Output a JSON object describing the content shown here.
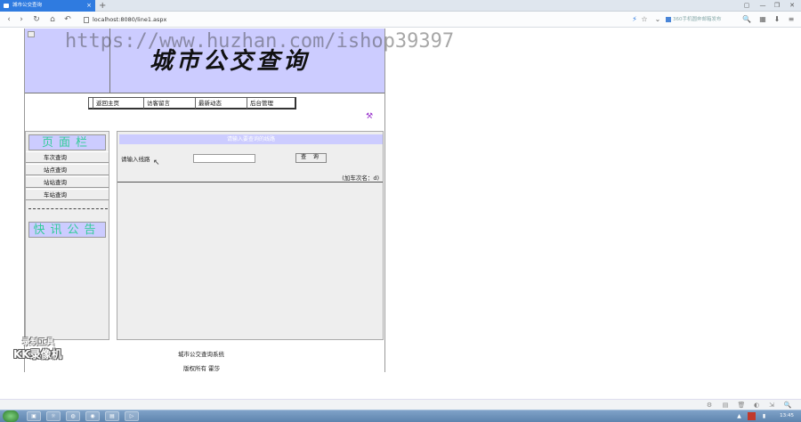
{
  "browser": {
    "tab_title": "城市公交查询",
    "tab_close": "×",
    "new_tab": "+",
    "url": "localhost:8080/line1.aspx",
    "search_placeholder": "360手机圆奔邮箱发布",
    "window_buttons": [
      "▢",
      "—",
      "❐",
      "✕"
    ],
    "nav_buttons": [
      "‹",
      "›",
      "↻",
      "⌂",
      "↶"
    ],
    "toolbar_icons": [
      "⚡",
      "☆",
      "⌄",
      "🔍",
      "▦",
      "⬇",
      "≡"
    ]
  },
  "page": {
    "watermark": "https://www.huzhan.com/ishop39397",
    "site_title": "城市公交查询",
    "nav_links": [
      "返回主页",
      "访客留言",
      "最新动态",
      "后台管理"
    ],
    "sidebar": {
      "header1": "页面栏",
      "items": [
        "车次查询",
        "站点查询",
        "站站查询",
        "车站查询"
      ],
      "header2": "快讯公告"
    },
    "main": {
      "header": "请输入要查询的线路",
      "route_label": "请输入线路",
      "route_value": "",
      "query_button": "查 询",
      "results_note": "(加车次名：d)"
    },
    "footer": {
      "system_name": "城市公交查询系统",
      "copyright": "版权所有  霍莎"
    },
    "overlay": {
      "line1": "录制工具",
      "line2": "KK录像机"
    }
  },
  "statusbar": {
    "icons": [
      "⚙",
      "▤",
      "🗑",
      "◐",
      "⇲",
      "🔍"
    ]
  },
  "taskbar": {
    "clock": "13:45",
    "apps": [
      "▣",
      "☼",
      "◍",
      "◉",
      "▤",
      "▷"
    ]
  }
}
